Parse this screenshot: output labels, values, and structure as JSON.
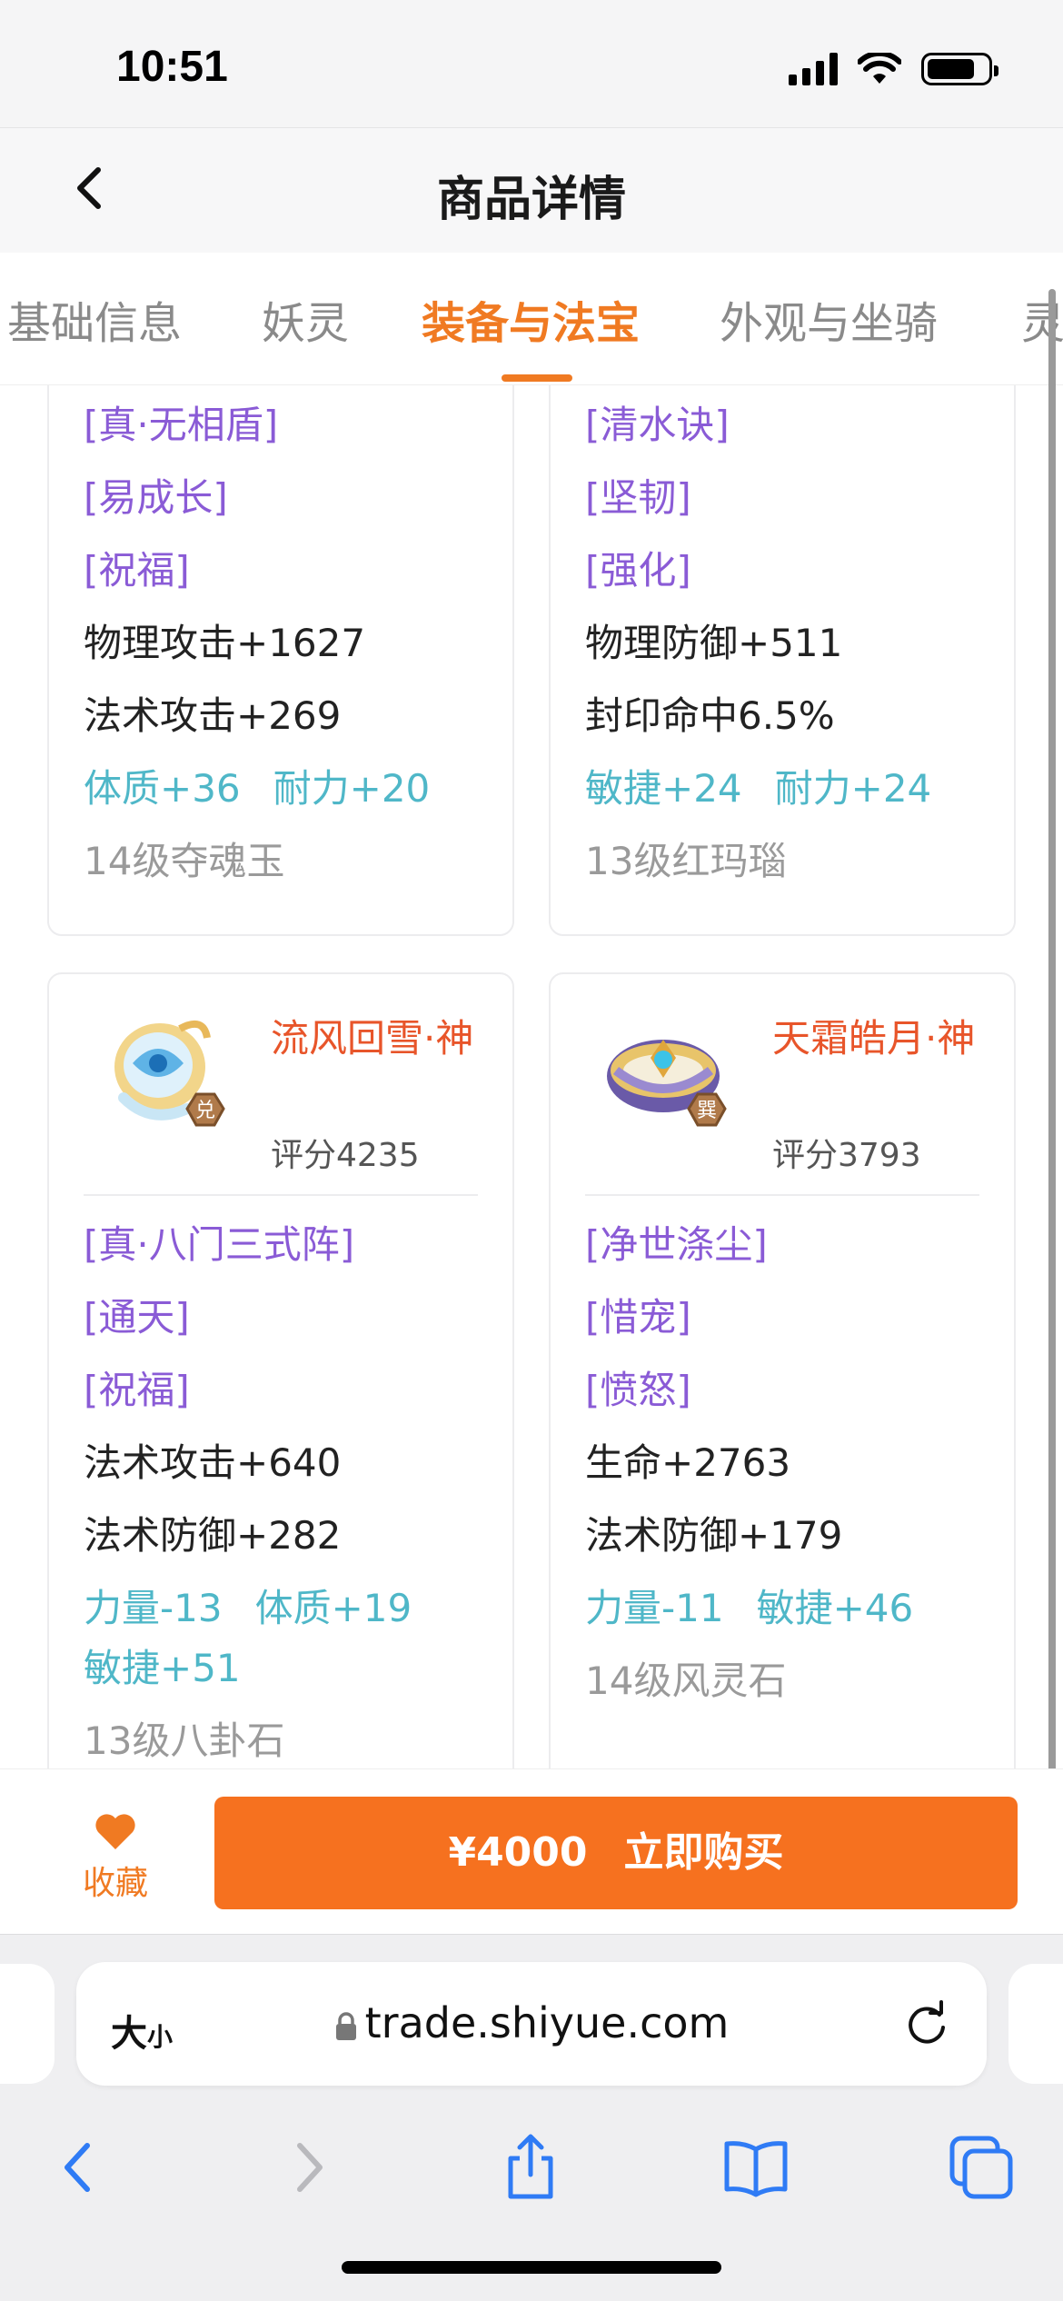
{
  "status_bar": {
    "time": "10:51"
  },
  "nav": {
    "title": "商品详情"
  },
  "tabs": [
    {
      "label": "基础信息"
    },
    {
      "label": "妖灵"
    },
    {
      "label": "装备与法宝"
    },
    {
      "label": "外观与坐骑"
    },
    {
      "label": "灵"
    }
  ],
  "active_tab": "装备与法宝",
  "cards": [
    {
      "tags": [
        "[真·无相盾]",
        "[易成长]",
        "[祝福]"
      ],
      "stats": [
        "物理攻击+1627",
        "法术攻击+269"
      ],
      "attrs": [
        "体质+36",
        "耐力+20"
      ],
      "gem": "14级夺魂玉"
    },
    {
      "tags": [
        "[清水诀]",
        "[坚韧]",
        "[强化]"
      ],
      "stats": [
        "物理防御+511",
        "封印命中6.5%"
      ],
      "attrs": [
        "敏捷+24",
        "耐力+24"
      ],
      "gem": "13级红玛瑙"
    },
    {
      "name": "流风回雪·神",
      "badge": "兑",
      "score": "评分4235",
      "tags": [
        "[真·八门三式阵]",
        "[通天]",
        "[祝福]"
      ],
      "stats": [
        "法术攻击+640",
        "法术防御+282"
      ],
      "attrs": [
        "力量-13",
        "体质+19",
        "敏捷+51"
      ],
      "gem": "13级八卦石"
    },
    {
      "name": "天霜皓月·神",
      "badge": "巽",
      "score": "评分3793",
      "tags": [
        "[净世涤尘]",
        "[惜宠]",
        "[愤怒]"
      ],
      "stats": [
        "生命+2763",
        "法术防御+179"
      ],
      "attrs": [
        "力量-11",
        "敏捷+46"
      ],
      "gem": "14级风灵石"
    }
  ],
  "action_bar": {
    "favorite_label": "收藏",
    "price": "¥4000",
    "buy_label": "立即购买"
  },
  "browser": {
    "text_size_label": "大",
    "text_size_small": "小",
    "url": "trade.shiyue.com"
  },
  "colors": {
    "accent": "#f07a22",
    "purple": "#8a5bd6",
    "teal": "#4fb7c8",
    "name_red": "#e8552a"
  }
}
